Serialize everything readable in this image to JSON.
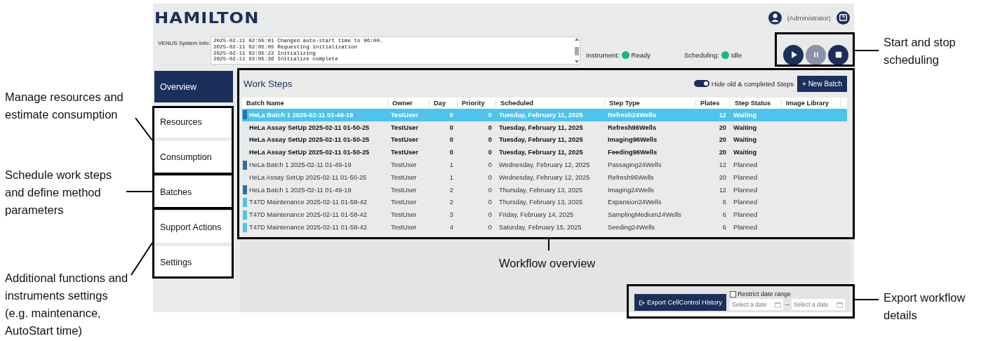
{
  "header": {
    "logo": "HAMILTON",
    "user": "(Administrator)"
  },
  "system_info": {
    "label": "VENUS System Info:",
    "log": [
      "2025-02-11 02:05:01 Changed auto-start time to 06:00.",
      "2025-02-11 02:05:05 Requesting initialization",
      "2025-02-11 02:05:22 Initializing",
      "2025-02-11 02:05:36 Initialize complete"
    ]
  },
  "status": [
    {
      "label": "Instrument:",
      "value": "Ready"
    },
    {
      "label": "Scheduling:",
      "value": "Idle"
    }
  ],
  "controls": [
    {
      "kind": "play",
      "disabled": false
    },
    {
      "kind": "pause",
      "disabled": true
    },
    {
      "kind": "stop",
      "disabled": false
    }
  ],
  "sidebar": {
    "items": [
      {
        "label": "Overview",
        "selected": true
      },
      {
        "label": "Resources",
        "selected": false
      },
      {
        "label": "Consumption",
        "selected": false
      },
      {
        "label": "Batches",
        "selected": false
      },
      {
        "label": "Support Actions",
        "selected": false
      },
      {
        "label": "Settings",
        "selected": false
      }
    ]
  },
  "work_steps": {
    "title": "Work Steps",
    "toggle": {
      "label": "Hide old & completed Steps",
      "on": true
    },
    "new_button": "+ New Batch",
    "columns": [
      "Batch Name",
      "Owner",
      "Day",
      "Priority",
      "Scheduled",
      "Step Type",
      "Plates",
      "Step Status",
      "Image Library"
    ],
    "rows": [
      {
        "color": "#2a6fa8",
        "selected": true,
        "bold": true,
        "cells": [
          "HeLa Batch 1 2025-02-11 01-49-19",
          "TestUser",
          "0",
          "0",
          "Tuesday, February 11, 2025",
          "Refresh24Wells",
          "12",
          "Waiting",
          ""
        ]
      },
      {
        "color": "#dcedf5",
        "selected": false,
        "bold": true,
        "cells": [
          "HeLa Assay SetUp 2025-02-11 01-50-25",
          "TestUser",
          "0",
          "0",
          "Tuesday, February 11, 2025",
          "Refresh96Wells",
          "20",
          "Waiting",
          ""
        ]
      },
      {
        "color": "#dcedf5",
        "selected": false,
        "bold": true,
        "cells": [
          "HeLa Assay SetUp 2025-02-11 01-50-25",
          "TestUser",
          "0",
          "0",
          "Tuesday, February 11, 2025",
          "Imaging96Wells",
          "20",
          "Waiting",
          ""
        ]
      },
      {
        "color": "#dcedf5",
        "selected": false,
        "bold": true,
        "cells": [
          "HeLa Assay SetUp 2025-02-11 01-50-25",
          "TestUser",
          "0",
          "0",
          "Tuesday, February 11, 2025",
          "Feeding96Wells",
          "20",
          "Waiting",
          ""
        ]
      },
      {
        "color": "#2a6fa8",
        "selected": false,
        "bold": false,
        "cells": [
          "HeLa Batch 1 2025-02-11 01-49-19",
          "TestUser",
          "1",
          "0",
          "Wednesday, February 12, 2025",
          "Passaging24Wells",
          "12",
          "Planned",
          ""
        ]
      },
      {
        "color": "#dcedf5",
        "selected": false,
        "bold": false,
        "cells": [
          "HeLa Assay SetUp 2025-02-11 01-50-25",
          "TestUser",
          "1",
          "0",
          "Wednesday, February 12, 2025",
          "Refresh96Wells",
          "20",
          "Planned",
          ""
        ]
      },
      {
        "color": "#2a6fa8",
        "selected": false,
        "bold": false,
        "cells": [
          "HeLa Batch 1 2025-02-11 01-49-19",
          "TestUser",
          "2",
          "0",
          "Thursday, February 13, 2025",
          "Imaging24Wells",
          "12",
          "Planned",
          ""
        ]
      },
      {
        "color": "#4cc4ec",
        "selected": false,
        "bold": false,
        "cells": [
          "T47D Maintenance 2025-02-11 01-58-42",
          "TestUser",
          "2",
          "0",
          "Thursday, February 13, 2025",
          "Expansion24Wells",
          "6",
          "Planned",
          ""
        ]
      },
      {
        "color": "#4cc4ec",
        "selected": false,
        "bold": false,
        "cells": [
          "T47D Maintenance 2025-02-11 01-58-42",
          "TestUser",
          "3",
          "0",
          "Friday, February 14, 2025",
          "SamplingMedium24Wells",
          "6",
          "Planned",
          ""
        ]
      },
      {
        "color": "#4cc4ec",
        "selected": false,
        "bold": false,
        "cells": [
          "T47D Maintenance 2025-02-11 01-58-42",
          "TestUser",
          "4",
          "0",
          "Saturday, February 15, 2025",
          "Seeding24Wells",
          "6",
          "Planned",
          ""
        ]
      }
    ]
  },
  "export": {
    "button": "Export CellControl History",
    "restrict": {
      "label": "Restrict date range",
      "checked": false
    },
    "from": {
      "placeholder": "Select a date"
    },
    "separator": "--",
    "to": {
      "placeholder": "Select a date"
    }
  },
  "annotations": [
    {
      "text": "Manage resources and\nestimate consumption"
    },
    {
      "text": "Schedule work steps\nand define method\nparameters"
    },
    {
      "text": "Additional functions and\ninstruments settings\n(e.g. maintenance,\nAutoStart time)"
    },
    {
      "text": "Start and stop\nscheduling"
    },
    {
      "text": "Export workflow\ndetails"
    },
    {
      "text": "Workflow overview"
    }
  ]
}
